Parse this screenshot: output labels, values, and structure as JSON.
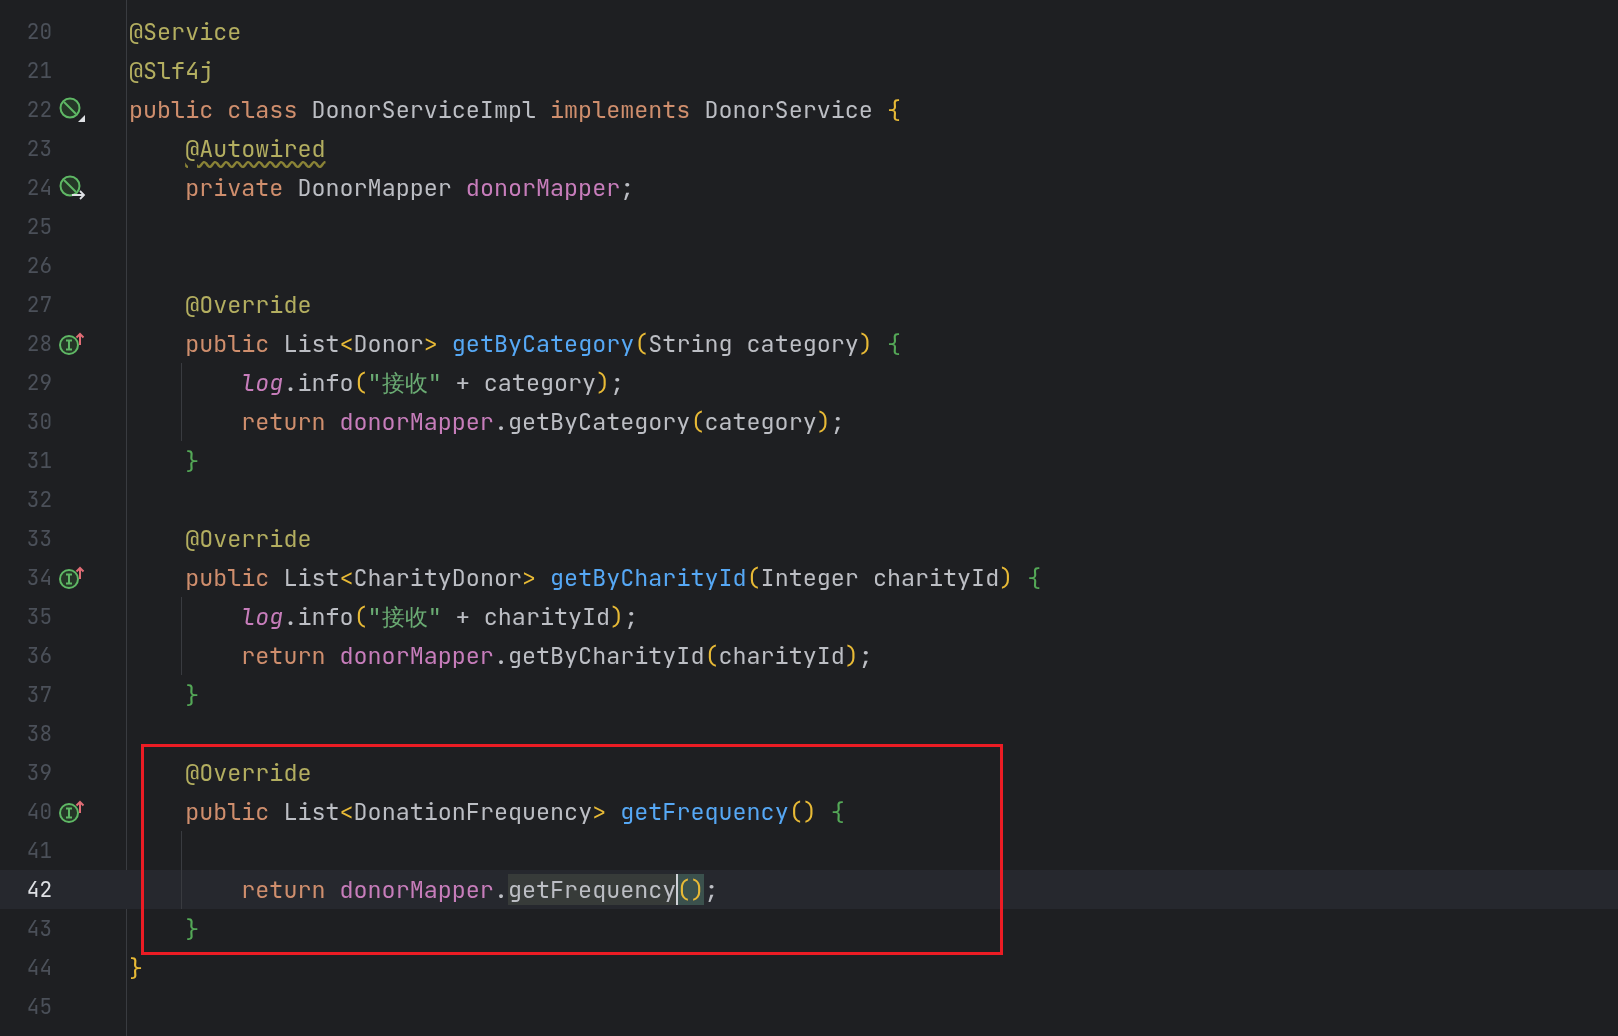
{
  "editor": {
    "blocks": [
      {
        "boxed": false,
        "lines": [
          {
            "n": "20",
            "selected": false,
            "indent_guide": false,
            "tokens": [
              {
                "t": "@Service",
                "kind": "annotation"
              }
            ]
          },
          {
            "n": "21",
            "selected": false,
            "indent_guide": false,
            "tokens": [
              {
                "t": "@Slf4j",
                "kind": "annotation"
              }
            ]
          },
          {
            "n": "22",
            "selected": false,
            "indent_guide": false,
            "marker": {
              "kind": "bean-class"
            },
            "tokens": [
              {
                "t": "public class ",
                "kind": "keyword"
              },
              {
                "t": "DonorServiceImpl ",
                "kind": "plain"
              },
              {
                "t": "implements ",
                "kind": "keyword"
              },
              {
                "t": "DonorService ",
                "kind": "plain"
              },
              {
                "t": "{",
                "kind": "bracket1"
              }
            ]
          },
          {
            "n": "23",
            "selected": false,
            "indent_guide": false,
            "tokens": [
              {
                "t": "    @Autowired",
                "kind": "annotation",
                "warning": true
              }
            ]
          },
          {
            "n": "24",
            "selected": false,
            "indent_guide": false,
            "marker": {
              "kind": "bean-injected"
            },
            "tokens": [
              {
                "t": "    private ",
                "kind": "keyword"
              },
              {
                "t": "DonorMapper ",
                "kind": "plain"
              },
              {
                "t": "donorMapper",
                "kind": "field"
              },
              {
                "t": ";",
                "kind": "plain"
              }
            ]
          },
          {
            "n": "25",
            "selected": false,
            "indent_guide": false
          },
          {
            "n": "26",
            "selected": false,
            "indent_guide": false
          },
          {
            "n": "27",
            "selected": false,
            "indent_guide": false,
            "tokens": [
              {
                "t": "    @Override",
                "kind": "annotation"
              }
            ]
          },
          {
            "n": "28",
            "selected": false,
            "indent_guide": false,
            "marker": {
              "kind": "implements"
            },
            "tokens": [
              {
                "t": "    public ",
                "kind": "keyword"
              },
              {
                "t": "List",
                "kind": "plain"
              },
              {
                "t": "<",
                "kind": "bracket1"
              },
              {
                "t": "Donor",
                "kind": "plain"
              },
              {
                "t": "> ",
                "kind": "bracket1"
              },
              {
                "t": "getByCategory",
                "kind": "method"
              },
              {
                "t": "(",
                "kind": "bracket1"
              },
              {
                "t": "String category",
                "kind": "plain"
              },
              {
                "t": ") ",
                "kind": "bracket1"
              },
              {
                "t": "{",
                "kind": "bracket2"
              }
            ]
          },
          {
            "n": "29",
            "selected": false,
            "indent_guide": true,
            "tokens": [
              {
                "t": "        log",
                "kind": "static"
              },
              {
                "t": ".info",
                "kind": "plain"
              },
              {
                "t": "(",
                "kind": "bracket1"
              },
              {
                "t": "\"接收\"",
                "kind": "string"
              },
              {
                "t": " + category",
                "kind": "plain"
              },
              {
                "t": ")",
                "kind": "bracket1"
              },
              {
                "t": ";",
                "kind": "plain"
              }
            ]
          },
          {
            "n": "30",
            "selected": false,
            "indent_guide": true,
            "tokens": [
              {
                "t": "        return ",
                "kind": "keyword"
              },
              {
                "t": "donorMapper",
                "kind": "field"
              },
              {
                "t": ".getByCategory",
                "kind": "plain"
              },
              {
                "t": "(",
                "kind": "bracket1"
              },
              {
                "t": "category",
                "kind": "plain"
              },
              {
                "t": ")",
                "kind": "bracket1"
              },
              {
                "t": ";",
                "kind": "plain"
              }
            ]
          },
          {
            "n": "31",
            "selected": false,
            "indent_guide": false,
            "tokens": [
              {
                "t": "    }",
                "kind": "bracket2"
              }
            ]
          },
          {
            "n": "32",
            "selected": false,
            "indent_guide": false
          },
          {
            "n": "33",
            "selected": false,
            "indent_guide": false,
            "tokens": [
              {
                "t": "    @Override",
                "kind": "annotation"
              }
            ]
          },
          {
            "n": "34",
            "selected": false,
            "indent_guide": false,
            "marker": {
              "kind": "implements"
            },
            "tokens": [
              {
                "t": "    public ",
                "kind": "keyword"
              },
              {
                "t": "List",
                "kind": "plain"
              },
              {
                "t": "<",
                "kind": "bracket1"
              },
              {
                "t": "CharityDonor",
                "kind": "plain"
              },
              {
                "t": "> ",
                "kind": "bracket1"
              },
              {
                "t": "getByCharityId",
                "kind": "method"
              },
              {
                "t": "(",
                "kind": "bracket1"
              },
              {
                "t": "Integer charityId",
                "kind": "plain"
              },
              {
                "t": ") ",
                "kind": "bracket1"
              },
              {
                "t": "{",
                "kind": "bracket2"
              }
            ]
          },
          {
            "n": "35",
            "selected": false,
            "indent_guide": true,
            "tokens": [
              {
                "t": "        log",
                "kind": "static"
              },
              {
                "t": ".info",
                "kind": "plain"
              },
              {
                "t": "(",
                "kind": "bracket1"
              },
              {
                "t": "\"接收\"",
                "kind": "string"
              },
              {
                "t": " + charityId",
                "kind": "plain"
              },
              {
                "t": ")",
                "kind": "bracket1"
              },
              {
                "t": ";",
                "kind": "plain"
              }
            ]
          },
          {
            "n": "36",
            "selected": false,
            "indent_guide": true,
            "tokens": [
              {
                "t": "        return ",
                "kind": "keyword"
              },
              {
                "t": "donorMapper",
                "kind": "field"
              },
              {
                "t": ".getByCharityId",
                "kind": "plain"
              },
              {
                "t": "(",
                "kind": "bracket1"
              },
              {
                "t": "charityId",
                "kind": "plain"
              },
              {
                "t": ")",
                "kind": "bracket1"
              },
              {
                "t": ";",
                "kind": "plain"
              }
            ]
          },
          {
            "n": "37",
            "selected": false,
            "indent_guide": false,
            "tokens": [
              {
                "t": "    }",
                "kind": "bracket2"
              }
            ]
          },
          {
            "n": "38",
            "selected": false,
            "indent_guide": false
          }
        ]
      },
      {
        "boxed": true,
        "lines": [
          {
            "n": "39",
            "selected": false,
            "indent_guide": false,
            "tokens": [
              {
                "t": "    @Override",
                "kind": "annotation"
              }
            ]
          },
          {
            "n": "40",
            "selected": false,
            "indent_guide": false,
            "marker": {
              "kind": "implements"
            },
            "tokens": [
              {
                "t": "    public ",
                "kind": "keyword"
              },
              {
                "t": "List",
                "kind": "plain"
              },
              {
                "t": "<",
                "kind": "bracket1"
              },
              {
                "t": "DonationFrequency",
                "kind": "plain"
              },
              {
                "t": "> ",
                "kind": "bracket1"
              },
              {
                "t": "getFrequency",
                "kind": "method"
              },
              {
                "t": "() ",
                "kind": "bracket1"
              },
              {
                "t": "{",
                "kind": "bracket2"
              }
            ]
          },
          {
            "n": "41",
            "selected": false,
            "indent_guide": true
          },
          {
            "n": "42",
            "selected": true,
            "indent_guide": true,
            "tokens": [
              {
                "t": "        return ",
                "kind": "keyword"
              },
              {
                "t": "donorMapper",
                "kind": "field"
              },
              {
                "t": ".",
                "kind": "plain"
              },
              {
                "t": "getFrequency",
                "kind": "usage"
              },
              {
                "t": "()",
                "kind": "matched",
                "caret": true
              },
              {
                "t": ";",
                "kind": "plain"
              }
            ]
          },
          {
            "n": "43",
            "selected": false,
            "indent_guide": false,
            "tokens": [
              {
                "t": "    }",
                "kind": "bracket2"
              }
            ]
          }
        ]
      },
      {
        "boxed": false,
        "lines": [
          {
            "n": "44",
            "selected": false,
            "indent_guide": false,
            "tokens": [
              {
                "t": "}",
                "kind": "bracket1"
              }
            ]
          },
          {
            "n": "45",
            "selected": false,
            "indent_guide": false
          }
        ]
      }
    ]
  }
}
